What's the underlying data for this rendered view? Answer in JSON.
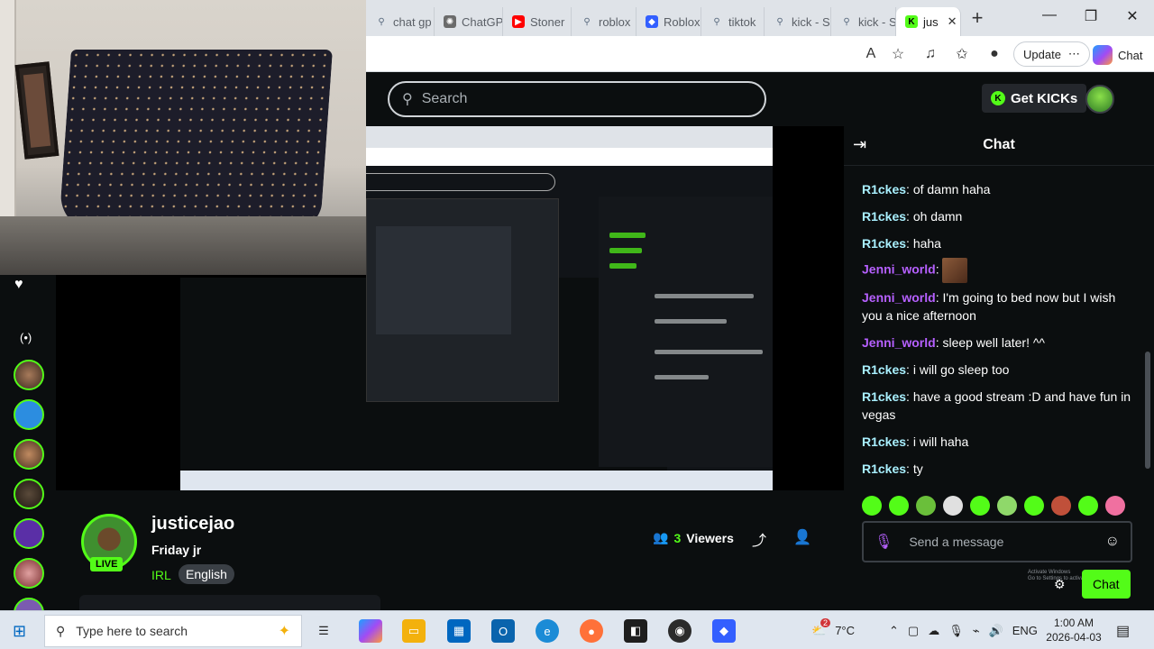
{
  "browser": {
    "tabs": [
      {
        "label": "chat gp",
        "icon": "search-icon",
        "color": "#5a6b7f"
      },
      {
        "label": "ChatGP",
        "icon": "chatgpt-icon",
        "color": "#6b6b6b"
      },
      {
        "label": "Stoner",
        "icon": "youtube-icon",
        "color": "#ff0000"
      },
      {
        "label": "roblox",
        "icon": "search-icon",
        "color": "#5a6b7f"
      },
      {
        "label": "Roblox",
        "icon": "roblox-icon",
        "color": "#335fff"
      },
      {
        "label": "tiktok",
        "icon": "search-icon",
        "color": "#5a6b7f"
      },
      {
        "label": "kick - S",
        "icon": "search-icon",
        "color": "#5a6b7f"
      },
      {
        "label": "kick - S",
        "icon": "search-icon",
        "color": "#5a6b7f"
      },
      {
        "label": "jus",
        "icon": "kick-icon",
        "color": "#53fc18",
        "active": true
      }
    ],
    "update_label": "Update",
    "copilot_label": "Chat"
  },
  "site": {
    "search_placeholder": "Search",
    "get_kicks_label": "Get KICKs",
    "accent": "#53fc18"
  },
  "channel": {
    "name": "justicejao",
    "live_badge": "LIVE",
    "stream_title": "Friday jr",
    "category": "IRL",
    "language": "English",
    "viewers_count": "3",
    "viewers_label": "Viewers"
  },
  "chat": {
    "title": "Chat",
    "messages": [
      {
        "user": "R1ckes",
        "color": "#a9f0ff",
        "text": "of damn haha"
      },
      {
        "user": "R1ckes",
        "color": "#a9f0ff",
        "text": "oh damn"
      },
      {
        "user": "R1ckes",
        "color": "#a9f0ff",
        "text": "haha"
      },
      {
        "user": "Jenni_world",
        "color": "#b660ff",
        "text": "",
        "emote": true
      },
      {
        "user": "Jenni_world",
        "color": "#b660ff",
        "text": "I'm going to bed now but I wish you a nice afternoon"
      },
      {
        "user": "Jenni_world",
        "color": "#b660ff",
        "text": "sleep well later! ^^"
      },
      {
        "user": "R1ckes",
        "color": "#a9f0ff",
        "text": "i will go sleep too"
      },
      {
        "user": "R1ckes",
        "color": "#a9f0ff",
        "text": "have a good stream :D and have fun in vegas"
      },
      {
        "user": "R1ckes",
        "color": "#a9f0ff",
        "text": "i will haha"
      },
      {
        "user": "R1ckes",
        "color": "#a9f0ff",
        "text": "ty"
      }
    ],
    "send_placeholder": "Send a message",
    "send_label": "Chat",
    "activate_line1": "Activate Windows",
    "activate_line2": "Go to Settings to activate"
  },
  "taskbar": {
    "search_placeholder": "Type here to search",
    "weather_badge": "2",
    "temperature": "7°C",
    "language": "ENG",
    "time": "1:00 AM",
    "date": "2026-04-03"
  }
}
